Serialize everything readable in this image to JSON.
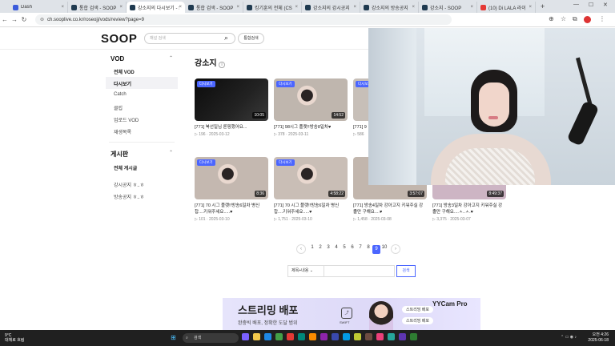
{
  "browser": {
    "tabs": [
      {
        "title": "Dash",
        "color": "#3b5bdb",
        "active": false
      },
      {
        "title": "통합 검색 - SOOP",
        "color": "#1f3a50",
        "active": false
      },
      {
        "title": "강소지의 다시보기 - S",
        "color": "#1f3a50",
        "active": true
      },
      {
        "title": "통합 검색 - SOOP",
        "color": "#1f3a50",
        "active": false
      },
      {
        "title": "킹기훈의 전체 (CS",
        "color": "#1f3a50",
        "active": false
      },
      {
        "title": "강소지의 강시공지",
        "color": "#1f3a50",
        "active": false
      },
      {
        "title": "강소지의 방송공지",
        "color": "#1f3a50",
        "active": false
      },
      {
        "title": "강소지 - SOOP",
        "color": "#1f3a50",
        "active": false
      },
      {
        "title": "(10) Di LALA 라이",
        "color": "#e53935",
        "active": false
      }
    ],
    "url": "ch.sooplive.co.kr/roseojj/vods/review?page=9"
  },
  "header": {
    "logo": "SOOP",
    "search_placeholder": "채널 검색",
    "integrated_search": "통합검색"
  },
  "sidebar": {
    "vod_title": "VOD",
    "vod_items": [
      {
        "label": "전체 VOD",
        "active": false,
        "bold": true
      },
      {
        "label": "다시보기",
        "active": true,
        "bold": false
      },
      {
        "label": "Catch",
        "active": false,
        "bold": false
      },
      {
        "label": "클립",
        "active": false,
        "bold": false
      },
      {
        "label": "업로드 VOD",
        "active": false,
        "bold": false
      },
      {
        "label": "재생목록",
        "active": false,
        "bold": false
      }
    ],
    "board_title": "게시판",
    "board_items": [
      {
        "label": "전체 게시글",
        "bold": true
      },
      {
        "label": "강시공지 ㅎ..ㅎ",
        "bold": false
      },
      {
        "label": "방송공지 ㅎ..ㅎ",
        "bold": false
      }
    ]
  },
  "content": {
    "title": "강소지",
    "info_icon": "i",
    "cards": [
      {
        "badge": "다시보기",
        "duration": "10:05",
        "title": "[771] 북선일님 론핑했어요...",
        "meta": "▷ 196 · 2025-03-12",
        "thumb": "#111"
      },
      {
        "badge": "다시보기",
        "duration": "14:52",
        "title": "[771] 98시그 플랫!!방송8일차♥",
        "meta": "▷ 378 · 2025-03-11",
        "thumb": "#bfb6ae"
      },
      {
        "badge": "다시보기",
        "duration": "",
        "title": "[771] 9",
        "meta": "▷ 586",
        "thumb": "#c7bfb8"
      },
      {
        "badge": "다시보기",
        "duration": "8:36",
        "title": "[771] 70 시그 플랫!!방송6일차 병신찹....키워주세요.....♥",
        "meta": "▷ 101 · 2025-03-10",
        "thumb": "#c4b8b0"
      },
      {
        "badge": "다시보기",
        "duration": "4:58:22",
        "title": "[771] 70 시그 플랫!!방송6일차 병신찹....키워주세요.....♥",
        "meta": "▷ 1,751 · 2025-03-10",
        "thumb": "#c9beb6"
      },
      {
        "badge": "",
        "duration": "3:57:07",
        "title": "[771] 방송4일차 강아고지 키워주실 강졸만 구해요....♥",
        "meta": "▷ 1,458 · 2025-03-08",
        "thumb": "#c2b6ad"
      },
      {
        "badge": "",
        "duration": "8:49:37",
        "title": "[771] 방송3일차 강아고지 키워주실 강졸만 구해요....ㅅ..ㅅ.♥",
        "meta": "▷ 3,375 · 2025-03-07",
        "thumb": "#cdb5c4"
      }
    ],
    "pagination": {
      "prev": "‹",
      "next": "›",
      "pages": [
        "1",
        "2",
        "3",
        "4",
        "5",
        "6",
        "7",
        "8",
        "9",
        "10"
      ],
      "current": "9"
    },
    "filter": {
      "select": "제목+내용",
      "button": "검색"
    }
  },
  "ad": {
    "title": "스트리밍 배포",
    "subtitle": "완충빅 배포, 정확한 도달 범위",
    "shield_caption": "SWIFT",
    "pill1": "스트리밍 배포",
    "pill2": "스트리밍 배포",
    "brand": "YYCam Pro"
  },
  "taskbar": {
    "weather_temp": "9°C",
    "weather_desc": "대체로 흐림",
    "search": "검색",
    "time": "오전 4:26",
    "date": "2025-06-18"
  }
}
